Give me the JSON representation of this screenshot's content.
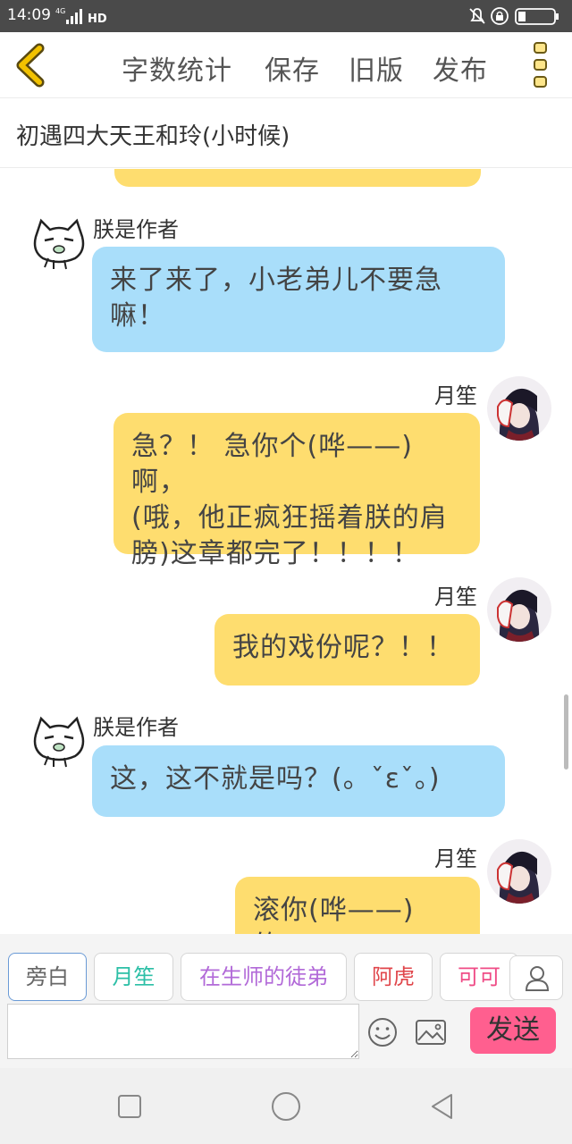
{
  "status_bar": {
    "time": "14:09",
    "network": "4G",
    "hd": "HD"
  },
  "toolbar": {
    "word_count": "字数统计",
    "save": "保存",
    "old_version": "旧版",
    "publish": "发布"
  },
  "chapter": {
    "title": "初遇四大天王和玲(小时候)"
  },
  "messages": [
    {
      "sender": "朕是作者",
      "side": "left",
      "text_lines": [
        "来了来了，小老弟儿不要急",
        "嘛！"
      ]
    },
    {
      "sender": "月笙",
      "side": "right",
      "text_lines": [
        "急？！ 急你个(哗——)啊，",
        "(哦，他正疯狂摇着朕的肩",
        "膀)这章都完了！！！！"
      ]
    },
    {
      "sender": "月笙",
      "side": "right",
      "text_lines": [
        "我的戏份呢？！！"
      ]
    },
    {
      "sender": "朕是作者",
      "side": "left",
      "text_lines": [
        "这，这不就是吗？(。ˇεˇ。)"
      ]
    },
    {
      "sender": "月笙",
      "side": "right",
      "text_lines": [
        "滚你(哗——)的！"
      ]
    }
  ],
  "characters": [
    {
      "label": "旁白",
      "color": "#666666"
    },
    {
      "label": "月笙",
      "color": "#2cbfa6"
    },
    {
      "label": "在生师的徒弟",
      "color": "#b26ad8"
    },
    {
      "label": "阿虎",
      "color": "#e0464b"
    },
    {
      "label": "可可",
      "color": "#ef4c86"
    }
  ],
  "composer": {
    "placeholder": "",
    "send": "发送"
  },
  "colors": {
    "left_bubble": "#a9defa",
    "right_bubble": "#fedd6f",
    "send_button": "#ff5f8f",
    "back_arrow": "#f2c200"
  }
}
